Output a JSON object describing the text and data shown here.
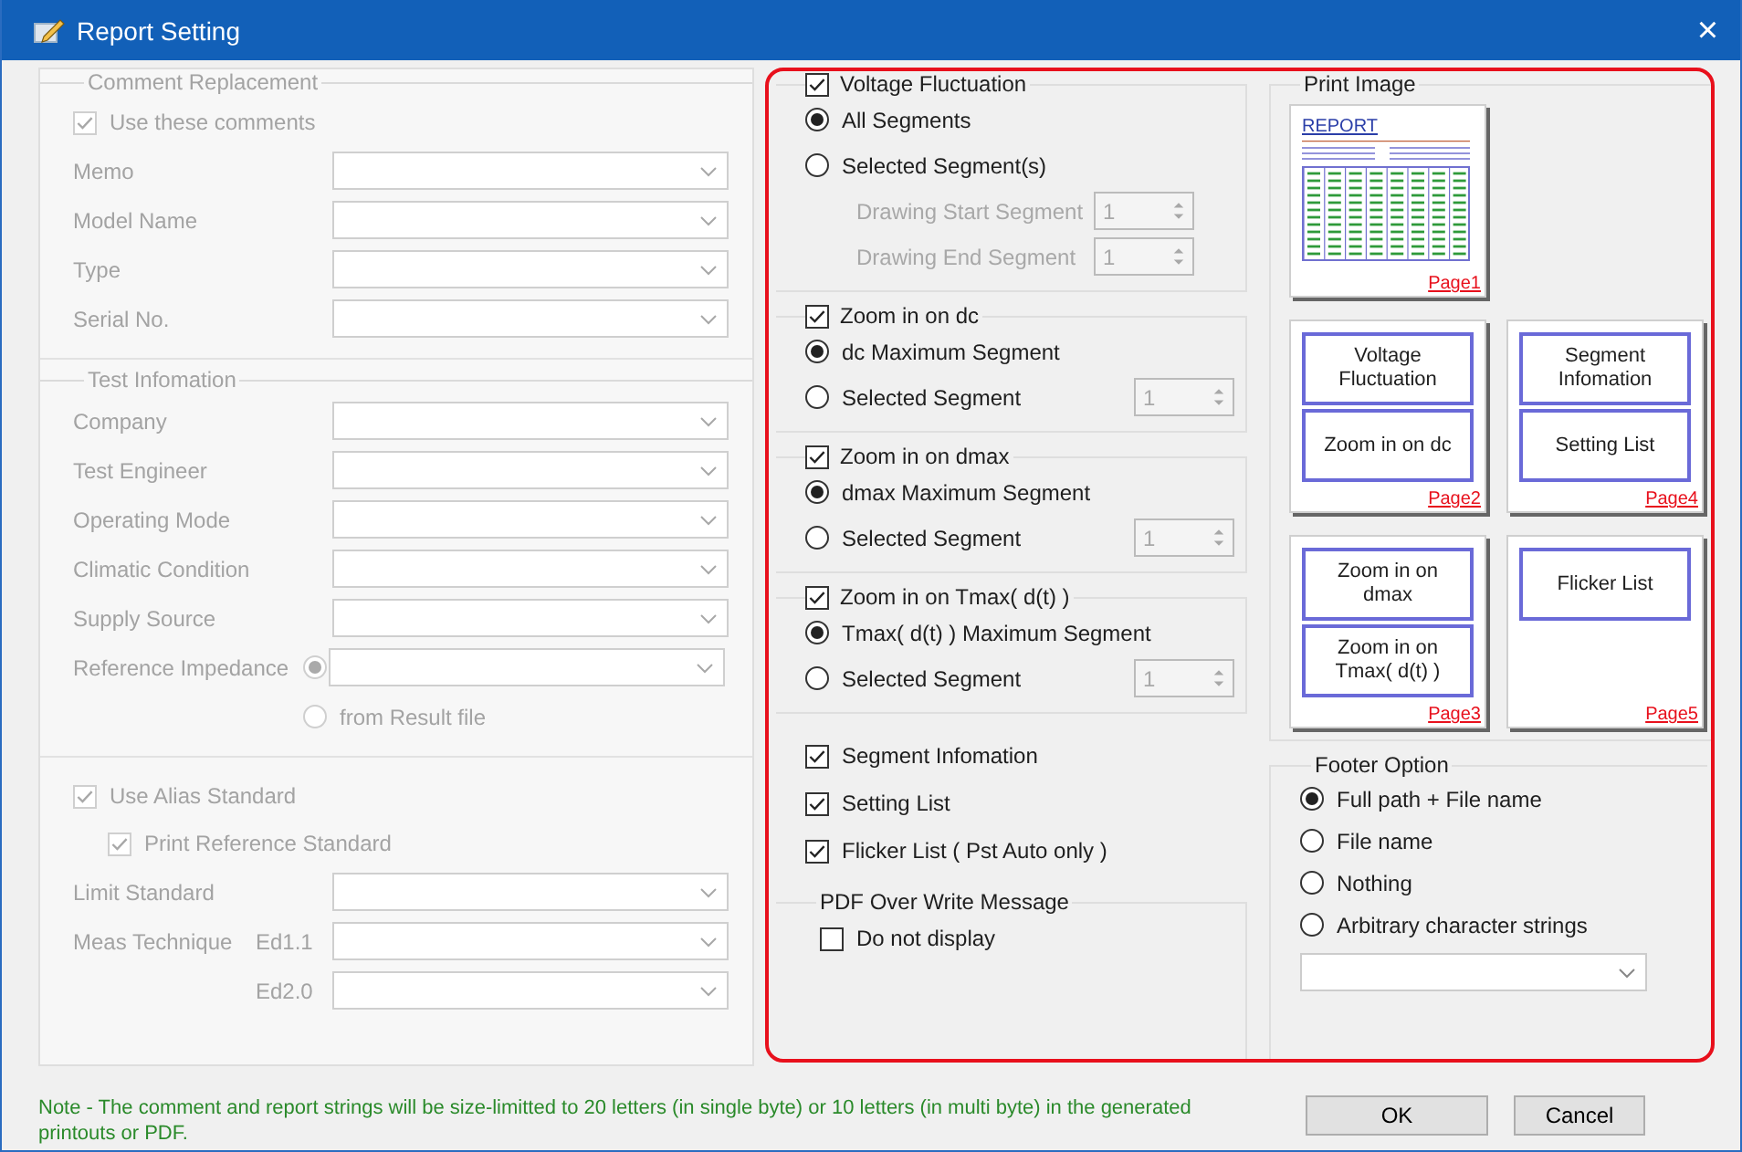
{
  "window": {
    "title": "Report Setting",
    "close": "×"
  },
  "left_panel": {
    "disabled": true,
    "comment_replacement": {
      "title": "Comment Replacement",
      "use_comments": {
        "label": "Use these comments",
        "checked": true
      },
      "fields": [
        {
          "label": "Memo"
        },
        {
          "label": "Model Name"
        },
        {
          "label": "Type"
        },
        {
          "label": "Serial No."
        }
      ]
    },
    "test_information": {
      "title": "Test Infomation",
      "fields": [
        {
          "label": "Company"
        },
        {
          "label": "Test Engineer"
        },
        {
          "label": "Operating Mode"
        },
        {
          "label": "Climatic Condition"
        },
        {
          "label": "Supply Source"
        }
      ],
      "reference_impedance": {
        "label": "Reference Impedance",
        "options": [
          {
            "kind": "combo",
            "selected": true
          },
          {
            "kind": "text",
            "label": "from Result file",
            "selected": false
          }
        ]
      }
    },
    "alias": {
      "use_alias": {
        "label": "Use Alias Standard",
        "checked": true
      },
      "print_reference": {
        "label": "Print Reference Standard",
        "checked": true
      },
      "limit_standard": {
        "label": "Limit Standard"
      },
      "meas_technique": {
        "label": "Meas Technique",
        "editions": [
          "Ed1.1",
          "Ed2.0"
        ]
      }
    }
  },
  "sections": [
    {
      "label": "Voltage Fluctuation",
      "checked": true,
      "options": [
        {
          "label": "All Segments",
          "selected": true
        },
        {
          "label": "Selected Segment(s)",
          "selected": false
        }
      ],
      "spinners": [
        {
          "label": "Drawing Start Segment",
          "value": "1",
          "disabled": true
        },
        {
          "label": "Drawing End Segment",
          "value": "1",
          "disabled": true
        }
      ]
    },
    {
      "label": "Zoom in on dc",
      "checked": true,
      "options": [
        {
          "label": "dc Maximum Segment",
          "selected": true
        },
        {
          "label": "Selected Segment",
          "selected": false,
          "spinner": {
            "value": "1",
            "disabled": true
          }
        }
      ]
    },
    {
      "label": "Zoom in on dmax",
      "checked": true,
      "options": [
        {
          "label": "dmax Maximum Segment",
          "selected": true
        },
        {
          "label": "Selected Segment",
          "selected": false,
          "spinner": {
            "value": "1",
            "disabled": true
          }
        }
      ]
    },
    {
      "label": "Zoom in on Tmax( d(t) )",
      "checked": true,
      "options": [
        {
          "label": "Tmax( d(t) ) Maximum Segment",
          "selected": true
        },
        {
          "label": "Selected Segment",
          "selected": false,
          "spinner": {
            "value": "1",
            "disabled": true
          }
        }
      ]
    }
  ],
  "outputs": [
    {
      "label": "Segment Infomation",
      "checked": true
    },
    {
      "label": "Setting List",
      "checked": true
    },
    {
      "label": "Flicker List ( Pst Auto only )",
      "checked": true
    }
  ],
  "pdf": {
    "title": "PDF Over Write Message",
    "option": {
      "label": "Do not display",
      "checked": false
    }
  },
  "print_image": {
    "title": "Print Image",
    "pages": [
      {
        "kind": "report",
        "heading": "REPORT",
        "label": "Page1"
      },
      {
        "kind": "empty"
      },
      {
        "kind": "blocks",
        "blocks": [
          "Voltage Fluctuation",
          "Zoom in on dc"
        ],
        "label": "Page2"
      },
      {
        "kind": "blocks",
        "blocks": [
          "Segment Infomation",
          "Setting List"
        ],
        "label": "Page4"
      },
      {
        "kind": "blocks",
        "blocks": [
          "Zoom in on dmax",
          "Zoom in on Tmax( d(t) )"
        ],
        "label": "Page3"
      },
      {
        "kind": "blocks",
        "blocks": [
          "Flicker List"
        ],
        "label": "Page5"
      }
    ]
  },
  "footer_option": {
    "title": "Footer Option",
    "options": [
      {
        "label": "Full path + File name",
        "selected": true
      },
      {
        "label": "File name",
        "selected": false
      },
      {
        "label": "Nothing",
        "selected": false
      },
      {
        "label": "Arbitrary character strings",
        "selected": false
      }
    ]
  },
  "note": "Note - The comment and report strings will be size-limitted to 20 letters (in single byte) or 10 letters (in multi byte) in the generated printouts or PDF.",
  "buttons": [
    "OK",
    "Cancel"
  ]
}
